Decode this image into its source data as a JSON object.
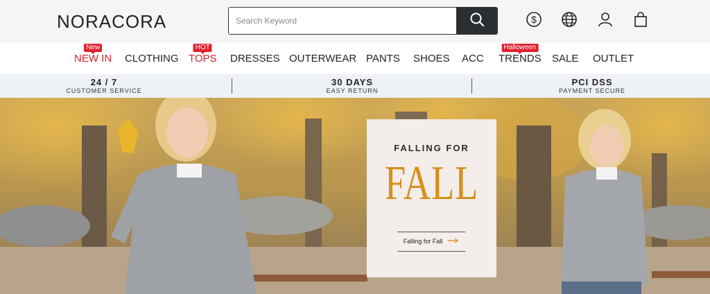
{
  "header": {
    "logo": "NORACORA",
    "search": {
      "placeholder": "Search Keyword",
      "value": ""
    },
    "icons": [
      "search-icon",
      "currency-dollar-icon",
      "globe-icon",
      "user-icon",
      "shopping-bag-icon"
    ]
  },
  "nav": {
    "items": [
      {
        "label": "NEW IN",
        "badge": "New",
        "highlight": true
      },
      {
        "label": "CLOTHING",
        "badge": ""
      },
      {
        "label": "TOPS",
        "badge": "HOT",
        "highlight": true
      },
      {
        "label": "DRESSES",
        "badge": ""
      },
      {
        "label": "OUTERWEAR",
        "badge": ""
      },
      {
        "label": "PANTS",
        "badge": ""
      },
      {
        "label": "SHOES",
        "badge": ""
      },
      {
        "label": "ACC",
        "badge": ""
      },
      {
        "label": "TRENDS",
        "badge": "Halloween"
      },
      {
        "label": "SALE",
        "badge": ""
      },
      {
        "label": "OUTLET",
        "badge": ""
      }
    ]
  },
  "service": [
    {
      "title": "24 / 7",
      "sub": "CUSTOMER SERVICE"
    },
    {
      "title": "30 DAYS",
      "sub": "EASY RETURN"
    },
    {
      "title": "PCI DSS",
      "sub": "PAYMENT SECURE"
    }
  ],
  "banner": {
    "overline": "FALLING FOR",
    "headline": "FALL",
    "link": "Falling for Fall"
  },
  "colors": {
    "accent_red": "#e0202e",
    "nav_red": "#d81e2c",
    "gold": "#d6901c",
    "search_button": "#2b2f33",
    "service_bg": "#eef1f5"
  }
}
